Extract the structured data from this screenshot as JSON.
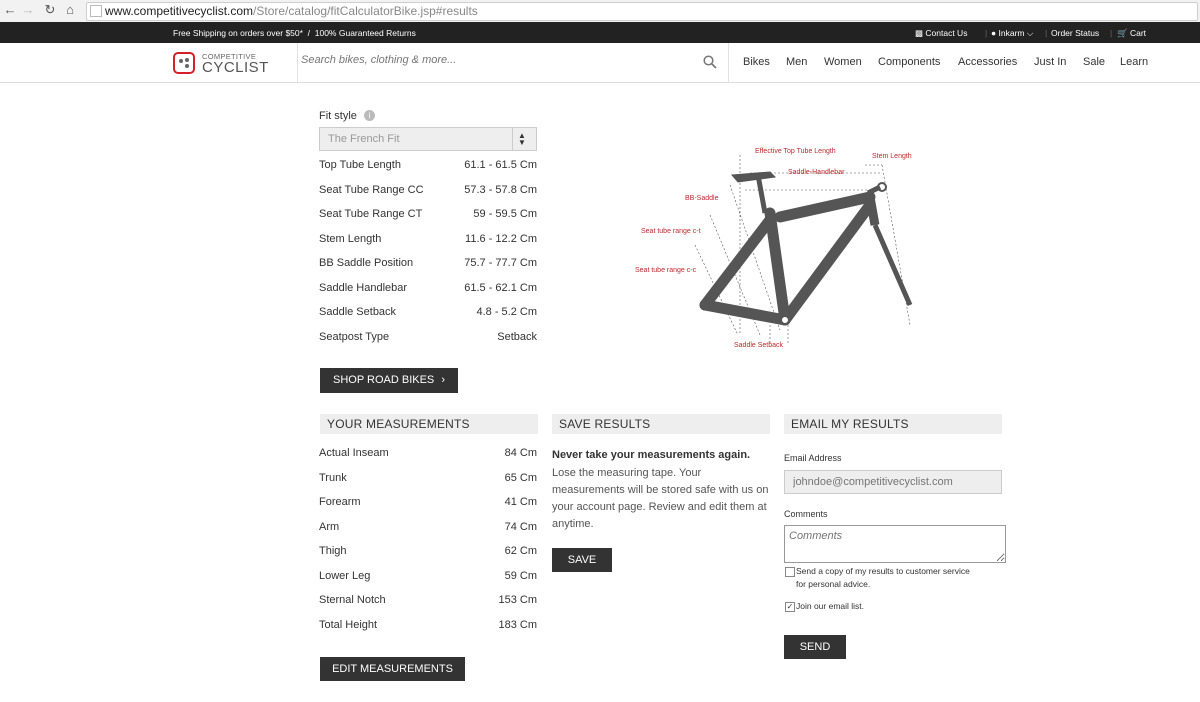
{
  "browser": {
    "url_domain": "www.competitivecyclist.com",
    "url_path": "/Store/catalog/fitCalculatorBike.jsp#results"
  },
  "promo": {
    "shipping": "Free Shipping on orders over $50*  /  100% Guaranteed Returns",
    "contact": "Contact Us",
    "user": "Inkarm",
    "order_status": "Order Status",
    "cart": "Cart"
  },
  "logo": {
    "line1": "COMPETITIVE",
    "line2": "CYCLIST",
    "color": "#d6202a"
  },
  "search": {
    "placeholder": "Search bikes, clothing & more..."
  },
  "nav": [
    "Bikes",
    "Men",
    "Women",
    "Components",
    "Accessories",
    "Just In",
    "Sale",
    "Learn"
  ],
  "fit": {
    "style_label": "Fit style",
    "style_value": "The French Fit",
    "rows": [
      {
        "label": "Top Tube Length",
        "value": "61.1 - 61.5 Cm"
      },
      {
        "label": "Seat Tube Range CC",
        "value": "57.3 - 57.8 Cm"
      },
      {
        "label": "Seat Tube Range CT",
        "value": "59 - 59.5 Cm"
      },
      {
        "label": "Stem Length",
        "value": "11.6 - 12.2 Cm"
      },
      {
        "label": "BB Saddle Position",
        "value": "75.7 - 77.7 Cm"
      },
      {
        "label": "Saddle Handlebar",
        "value": "61.5 - 62.1 Cm"
      },
      {
        "label": "Saddle Setback",
        "value": "4.8 - 5.2 Cm"
      },
      {
        "label": "Seatpost Type",
        "value": "Setback"
      }
    ],
    "shop_button": "SHOP ROAD BIKES"
  },
  "diagram": {
    "labels": {
      "top_tube": "Effective Top Tube Length",
      "stem": "Stem Length",
      "saddle_handlebar": "Saddle-Handlebar",
      "bb_saddle": "BB-Saddle",
      "seat_ct": "Seat tube range c-t",
      "seat_cc": "Seat tube range c-c",
      "setback": "Saddle Setback"
    },
    "label_color": "#c0282d",
    "frame_color": "#555555"
  },
  "measurements": {
    "title": "YOUR MEASUREMENTS",
    "rows": [
      {
        "label": "Actual Inseam",
        "value": "84 Cm"
      },
      {
        "label": "Trunk",
        "value": "65 Cm"
      },
      {
        "label": "Forearm",
        "value": "41 Cm"
      },
      {
        "label": "Arm",
        "value": "74 Cm"
      },
      {
        "label": "Thigh",
        "value": "62 Cm"
      },
      {
        "label": "Lower Leg",
        "value": "59 Cm"
      },
      {
        "label": "Sternal Notch",
        "value": "153 Cm"
      },
      {
        "label": "Total Height",
        "value": "183 Cm"
      }
    ],
    "edit_button": "EDIT MEASUREMENTS"
  },
  "save": {
    "title": "SAVE RESULTS",
    "headline": "Never take your measurements again.",
    "body": "Lose the measuring tape. Your measurements will be stored safe with us on your account page. Review and edit them at anytime.",
    "button": "SAVE"
  },
  "email": {
    "title": "EMAIL MY RESULTS",
    "address_label": "Email Address",
    "address_placeholder": "johndoe@competitivecyclist.com",
    "comments_label": "Comments",
    "comments_placeholder": "Comments",
    "copy_checkbox": "Send a copy of my results to customer service",
    "copy_checkbox_2": "for personal advice.",
    "copy_checked": false,
    "join_checkbox": "Join our email list.",
    "join_checked": true,
    "button": "SEND"
  }
}
